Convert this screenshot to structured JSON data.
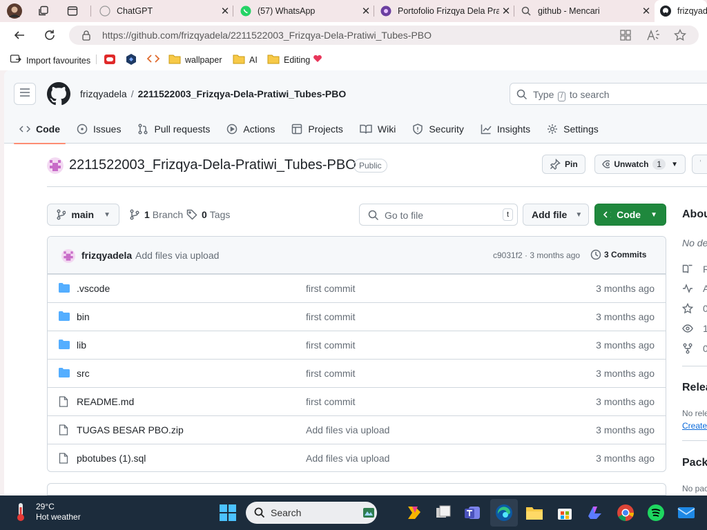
{
  "browser": {
    "tabs": [
      {
        "title": "ChatGPT",
        "icon": "chatgpt-icon"
      },
      {
        "title": "(57) WhatsApp",
        "icon": "whatsapp-icon"
      },
      {
        "title": "Portofolio Frizqya Dela Pra",
        "icon": "portfolio-icon"
      },
      {
        "title": "github - Mencari",
        "icon": "search-icon"
      },
      {
        "title": "frizqyad",
        "icon": "github-icon",
        "active": true
      }
    ],
    "url": "https://github.com/frizqyadela/2211522003_Frizqya-Dela-Pratiwi_Tubes-PBO",
    "favorites": [
      {
        "label": "Import favourites",
        "icon": "import-icon"
      },
      {
        "label": "",
        "icon": "red-app-icon"
      },
      {
        "label": "",
        "icon": "blue-shield-icon"
      },
      {
        "label": "",
        "icon": "code-brackets-icon"
      },
      {
        "label": "wallpaper",
        "icon": "folder-icon"
      },
      {
        "label": "AI",
        "icon": "folder-icon"
      },
      {
        "label": "Editing",
        "icon": "folder-icon"
      }
    ]
  },
  "github": {
    "owner": "frizqyadela",
    "crumb_sep": "/",
    "repo": "2211522003_Frizqya-Dela-Pratiwi_Tubes-PBO",
    "search": {
      "prefix": "Type",
      "key": "/",
      "suffix": "to search"
    },
    "nav": [
      {
        "label": "Code",
        "icon": "code-icon",
        "active": true
      },
      {
        "label": "Issues",
        "icon": "issue-icon"
      },
      {
        "label": "Pull requests",
        "icon": "pull-request-icon"
      },
      {
        "label": "Actions",
        "icon": "actions-icon"
      },
      {
        "label": "Projects",
        "icon": "projects-icon"
      },
      {
        "label": "Wiki",
        "icon": "wiki-icon"
      },
      {
        "label": "Security",
        "icon": "shield-icon"
      },
      {
        "label": "Insights",
        "icon": "graph-icon"
      },
      {
        "label": "Settings",
        "icon": "gear-icon"
      }
    ],
    "visibility": "Public",
    "pin_label": "Pin",
    "unwatch_label": "Unwatch",
    "watch_count": "1",
    "branch": "main",
    "branches": {
      "count": "1",
      "label": "Branch"
    },
    "tags": {
      "count": "0",
      "label": "Tags"
    },
    "goto_placeholder": "Go to file",
    "goto_key": "t",
    "add_file_label": "Add file",
    "code_label": "Code",
    "latest_commit": {
      "author": "frizqyadela",
      "message": "Add files via upload",
      "sha_time": "c9031f2 · 3 months ago",
      "commits_count": "3",
      "commits_label": "Commits"
    },
    "files": [
      {
        "name": ".vscode",
        "type": "dir",
        "commit": "first commit",
        "time": "3 months ago"
      },
      {
        "name": "bin",
        "type": "dir",
        "commit": "first commit",
        "time": "3 months ago"
      },
      {
        "name": "lib",
        "type": "dir",
        "commit": "first commit",
        "time": "3 months ago"
      },
      {
        "name": "src",
        "type": "dir",
        "commit": "first commit",
        "time": "3 months ago"
      },
      {
        "name": "README.md",
        "type": "file",
        "commit": "first commit",
        "time": "3 months ago"
      },
      {
        "name": "TUGAS BESAR PBO.zip",
        "type": "file",
        "commit": "Add files via upload",
        "time": "3 months ago"
      },
      {
        "name": "pbotubes (1).sql",
        "type": "file",
        "commit": "Add files via upload",
        "time": "3 months ago"
      }
    ],
    "sidebar": {
      "about": "Abou",
      "no_desc": "No de",
      "items": [
        {
          "icon": "book-icon",
          "text": "R"
        },
        {
          "icon": "pulse-icon",
          "text": "A"
        },
        {
          "icon": "star-icon",
          "text": "0"
        },
        {
          "icon": "eye-icon",
          "text": "1"
        },
        {
          "icon": "fork-icon",
          "text": "0"
        }
      ],
      "releases": "Relea",
      "no_releases": "No rele",
      "create_link": "Create",
      "packages": "Packa",
      "no_packages": "No pac"
    }
  },
  "taskbar": {
    "temperature": "29°C",
    "weather": "Hot weather",
    "search_label": "Search"
  },
  "colors": {
    "accent_green": "#1f883d",
    "nav_underline": "#fd8c73",
    "folder_blue": "#54aeff",
    "taskbar": "#1c2c3c"
  }
}
